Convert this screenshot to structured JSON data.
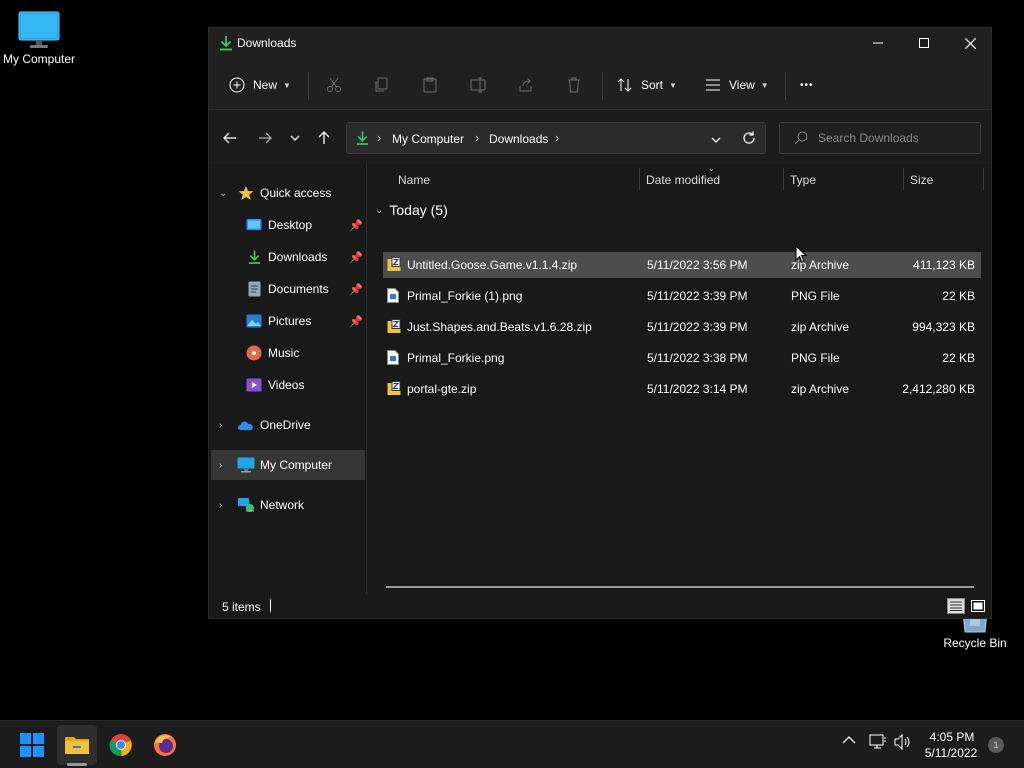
{
  "desktop": {
    "icons": [
      {
        "label": "My Computer"
      },
      {
        "label": "Recycle Bin"
      }
    ]
  },
  "window": {
    "title": "Downloads",
    "toolbar": {
      "new_label": "New",
      "sort_label": "Sort",
      "view_label": "View",
      "more_label": "•••"
    },
    "address": {
      "crumbs": [
        "My Computer",
        "Downloads"
      ],
      "separator": "›"
    },
    "search": {
      "placeholder": "Search Downloads"
    },
    "sidebar": {
      "quick_access": "Quick access",
      "items": [
        {
          "label": "Desktop",
          "pinned": true
        },
        {
          "label": "Downloads",
          "pinned": true
        },
        {
          "label": "Documents",
          "pinned": true
        },
        {
          "label": "Pictures",
          "pinned": true
        },
        {
          "label": "Music",
          "pinned": false
        },
        {
          "label": "Videos",
          "pinned": false
        }
      ],
      "onedrive": "OneDrive",
      "mycomputer": "My Computer",
      "network": "Network"
    },
    "columns": {
      "name": "Name",
      "date": "Date modified",
      "type": "Type",
      "size": "Size"
    },
    "group": {
      "label": "Today (5)"
    },
    "files": [
      {
        "name": "Untitled.Goose.Game.v1.1.4.zip",
        "date": "5/11/2022 3:56 PM",
        "type": "zip Archive",
        "size": "411,123 KB",
        "icon": "zip-icon",
        "selected": true
      },
      {
        "name": "Primal_Forkie (1).png",
        "date": "5/11/2022 3:39 PM",
        "type": "PNG File",
        "size": "22 KB",
        "icon": "png-icon",
        "selected": false
      },
      {
        "name": "Just.Shapes.and.Beats.v1.6.28.zip",
        "date": "5/11/2022 3:39 PM",
        "type": "zip Archive",
        "size": "994,323 KB",
        "icon": "zip-icon",
        "selected": false
      },
      {
        "name": "Primal_Forkie.png",
        "date": "5/11/2022 3:38 PM",
        "type": "PNG File",
        "size": "22 KB",
        "icon": "png-icon",
        "selected": false
      },
      {
        "name": "portal-gte.zip",
        "date": "5/11/2022 3:14 PM",
        "type": "zip Archive",
        "size": "2,412,280 KB",
        "icon": "zip-icon",
        "selected": false
      }
    ],
    "status": {
      "items_text": "5 items"
    }
  },
  "taskbar": {
    "clock_time": "4:05 PM",
    "clock_date": "5/11/2022",
    "notification_count": "1"
  },
  "colors": {
    "accent_green": "#3ec46d",
    "folder_yellow": "#f3c23b",
    "windows_blue": "#1e90ff"
  }
}
